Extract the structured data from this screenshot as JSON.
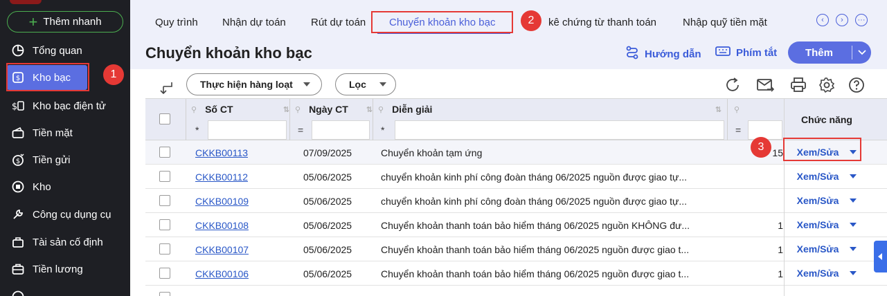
{
  "sidebar": {
    "quick_add": "Thêm nhanh",
    "items": [
      {
        "label": "Tổng quan",
        "icon": "pie-chart-icon"
      },
      {
        "label": "Kho bạc",
        "icon": "treasury-safe-icon"
      },
      {
        "label": "Kho bạc điện tử",
        "icon": "e-treasury-icon"
      },
      {
        "label": "Tiền mặt",
        "icon": "cash-icon"
      },
      {
        "label": "Tiền gửi",
        "icon": "deposit-icon"
      },
      {
        "label": "Kho",
        "icon": "warehouse-icon"
      },
      {
        "label": "Công cụ dụng cụ",
        "icon": "tools-icon"
      },
      {
        "label": "Tài sản cố định",
        "icon": "fixed-asset-icon"
      },
      {
        "label": "Tiền lương",
        "icon": "salary-icon"
      }
    ]
  },
  "tabs": [
    {
      "label": "Quy trình"
    },
    {
      "label": "Nhận dự toán"
    },
    {
      "label": "Rút dự toán"
    },
    {
      "label": "Chuyển khoản kho bạc"
    },
    {
      "label": "kê chứng từ thanh toán"
    },
    {
      "label": "Nhập quỹ tiền mặt"
    }
  ],
  "header": {
    "title": "Chuyển khoản kho bạc",
    "guide": "Hướng dẫn",
    "shortcuts": "Phím tắt",
    "add": "Thêm"
  },
  "toolbar": {
    "batch": "Thực hiện hàng loạt",
    "filter": "Lọc"
  },
  "table": {
    "columns": {
      "doc_no": "Số CT",
      "doc_date": "Ngày CT",
      "description": "Diễn giải",
      "function": "Chức năng"
    },
    "filters": {
      "doc_no": "*",
      "doc_date": "=",
      "description": "*",
      "amount": "="
    },
    "rows": [
      {
        "doc_no": "CKKB00113",
        "date": "07/09/2025",
        "desc": "Chuyển khoản tạm ứng",
        "amount": "15",
        "action": "Xem/Sửa"
      },
      {
        "doc_no": "CKKB00112",
        "date": "05/06/2025",
        "desc": "chuyển khoản kinh phí công đoàn tháng 06/2025 nguồn được giao tự...",
        "amount": "",
        "action": "Xem/Sửa"
      },
      {
        "doc_no": "CKKB00109",
        "date": "05/06/2025",
        "desc": "chuyển khoản kinh phí công đoàn tháng 06/2025 nguồn được giao tự...",
        "amount": "",
        "action": "Xem/Sửa"
      },
      {
        "doc_no": "CKKB00108",
        "date": "05/06/2025",
        "desc": "Chuyển khoản thanh toán bảo hiểm tháng 06/2025 nguồn KHÔNG đư...",
        "amount": "1",
        "action": "Xem/Sửa"
      },
      {
        "doc_no": "CKKB00107",
        "date": "05/06/2025",
        "desc": "Chuyển khoản thanh toán bảo hiểm tháng 06/2025 nguồn được giao t...",
        "amount": "1",
        "action": "Xem/Sửa"
      },
      {
        "doc_no": "CKKB00106",
        "date": "05/06/2025",
        "desc": "Chuyển khoản thanh toán bảo hiểm tháng 06/2025 nguồn được giao t...",
        "amount": "1",
        "action": "Xem/Sửa"
      }
    ]
  },
  "annotations": {
    "b1": "1",
    "b2": "2",
    "b3": "3"
  },
  "colors": {
    "accent": "#5b6ee1",
    "link": "#2957c7",
    "annotation": "#e53935",
    "sidebar": "#1e1f24"
  }
}
